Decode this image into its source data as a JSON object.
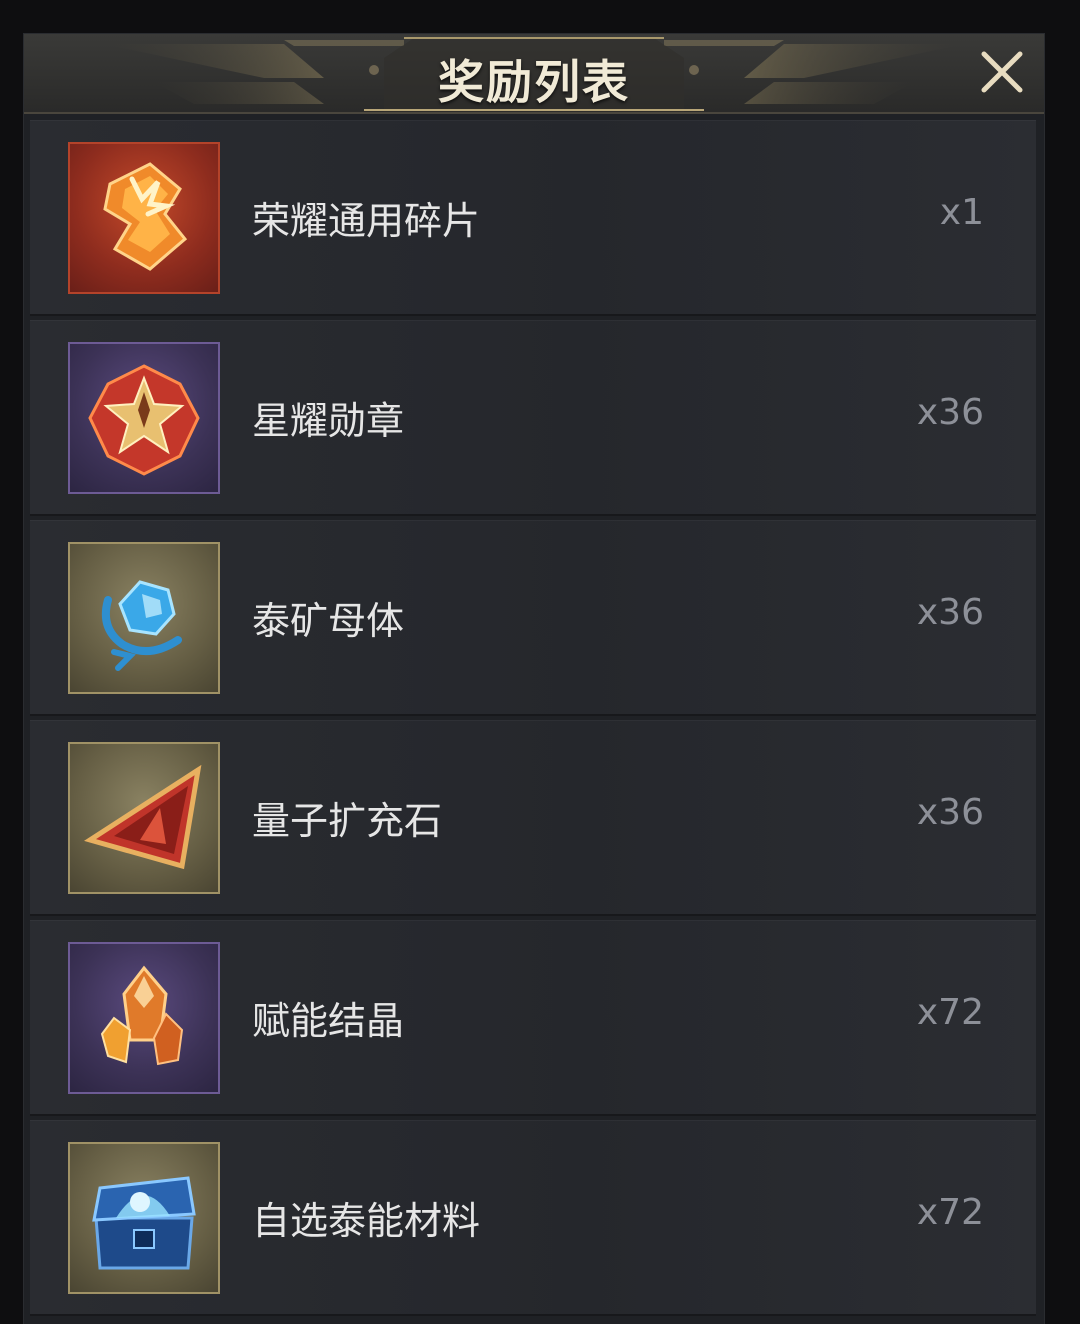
{
  "header": {
    "title": "奖励列表",
    "close_icon": "close-icon"
  },
  "rewards": [
    {
      "name": "荣耀通用碎片",
      "quantity": "x1",
      "icon": "glory-fragment-icon",
      "rarity_color": "#b4432a"
    },
    {
      "name": "星耀勋章",
      "quantity": "x36",
      "icon": "star-medal-icon",
      "rarity_color": "#6d5b95"
    },
    {
      "name": "泰矿母体",
      "quantity": "x36",
      "icon": "tai-ore-matrix-icon",
      "rarity_color": "#a09266"
    },
    {
      "name": "量子扩充石",
      "quantity": "x36",
      "icon": "quantum-expansion-stone-icon",
      "rarity_color": "#a09266"
    },
    {
      "name": "赋能结晶",
      "quantity": "x72",
      "icon": "empower-crystal-icon",
      "rarity_color": "#6d5b95"
    },
    {
      "name": "自选泰能材料",
      "quantity": "x72",
      "icon": "selectable-material-chest-icon",
      "rarity_color": "#a09266"
    }
  ]
}
